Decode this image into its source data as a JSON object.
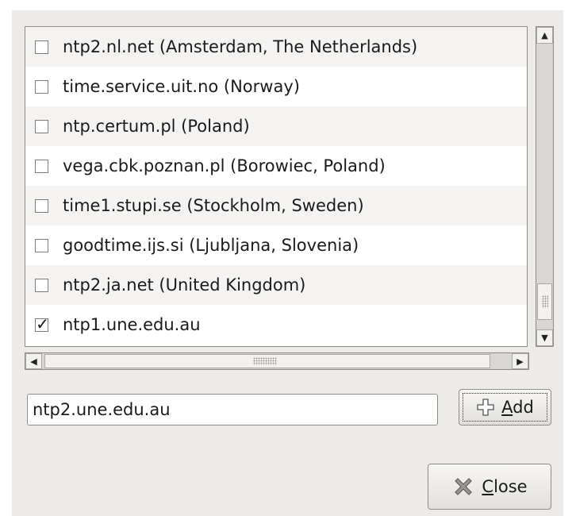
{
  "servers": [
    {
      "label": "ntp2.nl.net (Amsterdam, The Netherlands)",
      "checked": false
    },
    {
      "label": "time.service.uit.no (Norway)",
      "checked": false
    },
    {
      "label": "ntp.certum.pl (Poland)",
      "checked": false
    },
    {
      "label": "vega.cbk.poznan.pl (Borowiec, Poland)",
      "checked": false
    },
    {
      "label": "time1.stupi.se (Stockholm, Sweden)",
      "checked": false
    },
    {
      "label": "goodtime.ijs.si (Ljubljana, Slovenia)",
      "checked": false
    },
    {
      "label": "ntp2.ja.net (United Kingdom)",
      "checked": false
    },
    {
      "label": "ntp1.une.edu.au",
      "checked": true
    }
  ],
  "checkmark_glyph": "✓",
  "scrollbars": {
    "up_glyph": "▲",
    "down_glyph": "▼",
    "left_glyph": "◀",
    "right_glyph": "▶"
  },
  "new_server": {
    "value": "ntp2.une.edu.au"
  },
  "add_button": {
    "icon": "plus-icon",
    "mnemonic": "A",
    "rest": "dd"
  },
  "close_button": {
    "icon": "close-x-icon",
    "mnemonic": "C",
    "rest": "lose"
  },
  "colors": {
    "dialog_bg": "#edebe8",
    "row_alt": "#f4f3f1",
    "border": "#8d8c88"
  }
}
